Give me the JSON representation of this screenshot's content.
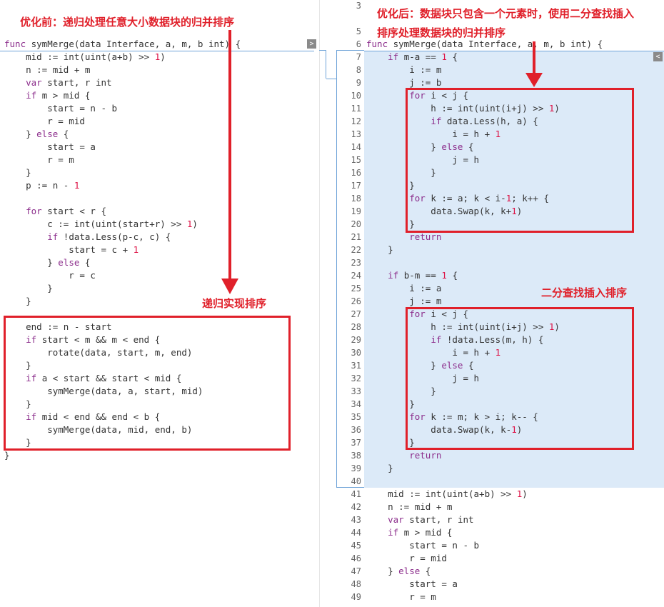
{
  "annotations": {
    "before_title": "优化前：递归处理任意大小数据块的归并排序",
    "after_title_line1": "优化后：数据块只包含一个元素时，使用二分查找插入",
    "after_title_line2": "排序处理数据块的归并排序",
    "recursive_label": "递归实现排序",
    "binary_insert_label": "二分查找插入排序"
  },
  "left_pane": {
    "nav_button": ">",
    "lines": [
      "func symMerge(data Interface, a, m, b int) {",
      "    mid := int(uint(a+b) >> 1)",
      "    n := mid + m",
      "    var start, r int",
      "    if m > mid {",
      "        start = n - b",
      "        r = mid",
      "    } else {",
      "        start = a",
      "        r = m",
      "    }",
      "    p := n - 1",
      "",
      "    for start < r {",
      "        c := int(uint(start+r) >> 1)",
      "        if !data.Less(p-c, c) {",
      "            start = c + 1",
      "        } else {",
      "            r = c",
      "        }",
      "    }",
      "",
      "    end := n - start",
      "    if start < m && m < end {",
      "        rotate(data, start, m, end)",
      "    }",
      "    if a < start && start < mid {",
      "        symMerge(data, a, start, mid)",
      "    }",
      "    if mid < end && end < b {",
      "        symMerge(data, mid, end, b)",
      "    }",
      "}"
    ]
  },
  "right_pane": {
    "nav_button": "<",
    "line_numbers": [
      "3",
      "5",
      "6",
      "7",
      "8",
      "9",
      "10",
      "11",
      "12",
      "13",
      "14",
      "15",
      "16",
      "17",
      "18",
      "19",
      "20",
      "21",
      "22",
      "23",
      "24",
      "25",
      "26",
      "27",
      "28",
      "29",
      "30",
      "31",
      "32",
      "33",
      "34",
      "35",
      "36",
      "37",
      "38",
      "39",
      "40",
      "41",
      "42",
      "43",
      "44",
      "45",
      "46",
      "47",
      "48",
      "49"
    ],
    "lines": [
      "",
      "",
      "func symMerge(data Interface, a, m, b int) {",
      "    if m-a == 1 {",
      "        i := m",
      "        j := b",
      "        for i < j {",
      "            h := int(uint(i+j) >> 1)",
      "            if data.Less(h, a) {",
      "                i = h + 1",
      "            } else {",
      "                j = h",
      "            }",
      "        }",
      "        for k := a; k < i-1; k++ {",
      "            data.Swap(k, k+1)",
      "        }",
      "        return",
      "    }",
      "",
      "    if b-m == 1 {",
      "        i := a",
      "        j := m",
      "        for i < j {",
      "            h := int(uint(i+j) >> 1)",
      "            if !data.Less(m, h) {",
      "                i = h + 1",
      "            } else {",
      "                j = h",
      "            }",
      "        }",
      "        for k := m; k > i; k-- {",
      "            data.Swap(k, k-1)",
      "        }",
      "        return",
      "    }",
      "",
      "    mid := int(uint(a+b) >> 1)",
      "    n := mid + m",
      "    var start, r int",
      "    if m > mid {",
      "        start = n - b",
      "        r = mid",
      "    } else {",
      "        start = a",
      "        r = m"
    ]
  }
}
